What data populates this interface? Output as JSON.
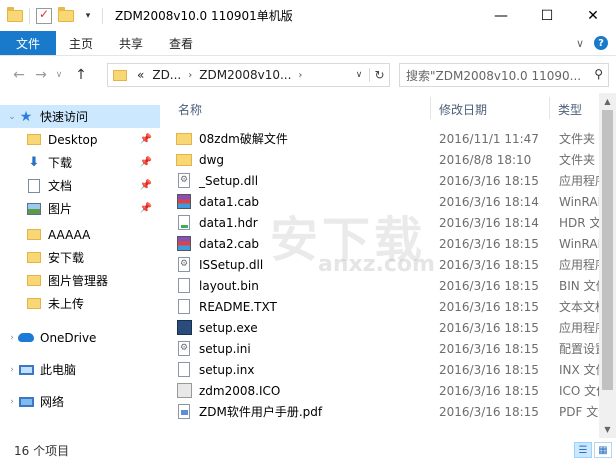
{
  "window": {
    "title": "ZDM2008v10.0 110901单机版",
    "minimize": "—",
    "maximize": "☐",
    "close": "✕"
  },
  "ribbon": {
    "tabs": [
      "文件",
      "主页",
      "共享",
      "查看"
    ],
    "collapse": "∨",
    "help": "?"
  },
  "nav": {
    "back": "←",
    "forward": "→",
    "recent": "∨",
    "up": "↑"
  },
  "address": {
    "prefix": "«",
    "crumbs": [
      "ZD...",
      "ZDM2008v10..."
    ],
    "dropdown": "∨",
    "refresh": "↻"
  },
  "search": {
    "placeholder": "搜索\"ZDM2008v10.0 11090...",
    "icon": "search-icon"
  },
  "navpane": {
    "quick_access": "快速访问",
    "items": [
      {
        "label": "Desktop",
        "icon": "folder-icon",
        "pinned": true
      },
      {
        "label": "下载",
        "icon": "download-icon",
        "pinned": true
      },
      {
        "label": "文档",
        "icon": "document-icon",
        "pinned": true
      },
      {
        "label": "图片",
        "icon": "picture-icon",
        "pinned": true
      },
      {
        "label": "AAAAA",
        "icon": "folder-icon",
        "pinned": false
      },
      {
        "label": "安下载",
        "icon": "folder-icon",
        "pinned": false
      },
      {
        "label": "图片管理器",
        "icon": "folder-icon",
        "pinned": false
      },
      {
        "label": "未上传",
        "icon": "folder-icon",
        "pinned": false
      }
    ],
    "onedrive": "OneDrive",
    "this_pc": "此电脑",
    "network": "网络"
  },
  "columns": {
    "name": "名称",
    "date": "修改日期",
    "type": "类型"
  },
  "files": [
    {
      "name": "08zdm破解文件",
      "date": "2016/11/1 11:47",
      "type": "文件夹",
      "icon": "folder-icon"
    },
    {
      "name": "dwg",
      "date": "2016/8/8 18:10",
      "type": "文件夹",
      "icon": "folder-icon"
    },
    {
      "name": "_Setup.dll",
      "date": "2016/3/16 18:15",
      "type": "应用程序",
      "icon": "dll-icon"
    },
    {
      "name": "data1.cab",
      "date": "2016/3/16 18:14",
      "type": "WinRAR",
      "icon": "rar-icon"
    },
    {
      "name": "data1.hdr",
      "date": "2016/3/16 18:14",
      "type": "HDR 文件",
      "icon": "hdr-icon"
    },
    {
      "name": "data2.cab",
      "date": "2016/3/16 18:15",
      "type": "WinRAR",
      "icon": "rar-icon"
    },
    {
      "name": "ISSetup.dll",
      "date": "2016/3/16 18:15",
      "type": "应用程序",
      "icon": "dll-icon"
    },
    {
      "name": "layout.bin",
      "date": "2016/3/16 18:15",
      "type": "BIN 文件",
      "icon": "file-icon"
    },
    {
      "name": "README.TXT",
      "date": "2016/3/16 18:15",
      "type": "文本文档",
      "icon": "text-file-icon"
    },
    {
      "name": "setup.exe",
      "date": "2016/3/16 18:15",
      "type": "应用程序",
      "icon": "exe-icon"
    },
    {
      "name": "setup.ini",
      "date": "2016/3/16 18:15",
      "type": "配置设置",
      "icon": "ini-icon"
    },
    {
      "name": "setup.inx",
      "date": "2016/3/16 18:15",
      "type": "INX 文件",
      "icon": "file-icon"
    },
    {
      "name": "zdm2008.ICO",
      "date": "2016/3/16 18:15",
      "type": "ICO 文件",
      "icon": "ico-file-icon"
    },
    {
      "name": "ZDM软件用户手册.pdf",
      "date": "2016/3/16 18:15",
      "type": "PDF 文件",
      "icon": "pdf-icon"
    }
  ],
  "status": {
    "count": "16 个项目"
  },
  "watermark": {
    "main": "安下载",
    "sub": "anxz.com"
  }
}
